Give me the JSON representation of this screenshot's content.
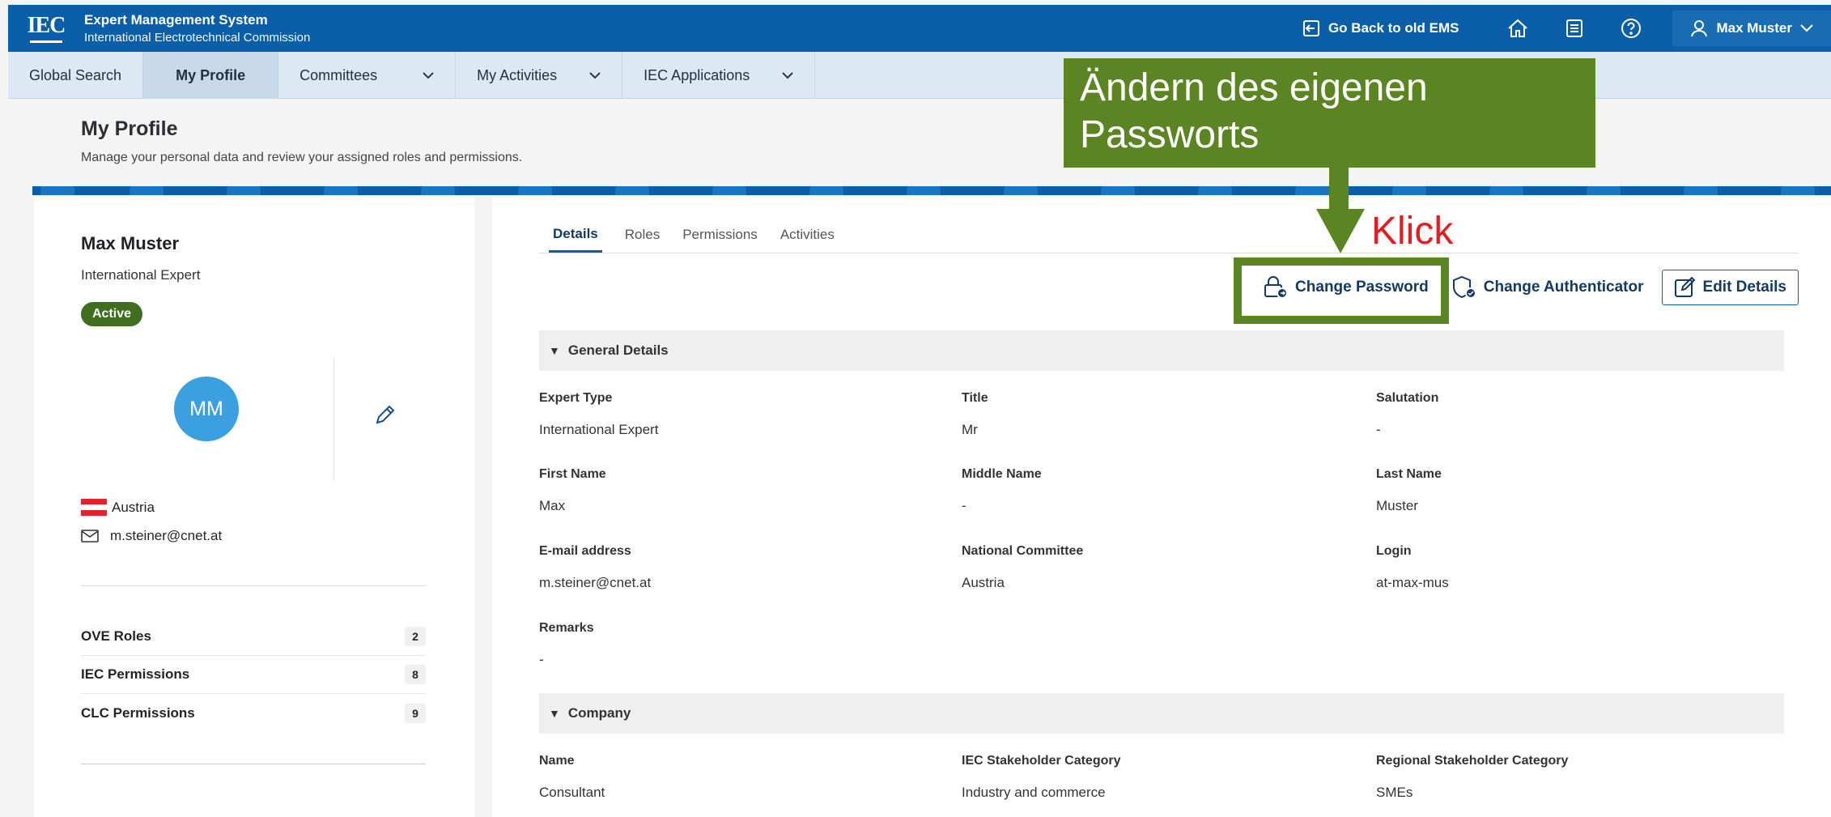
{
  "topbar": {
    "logo_text": "IEC",
    "app_title": "Expert Management System",
    "org_name": "International Electrotechnical Commission",
    "go_back_label": "Go Back to old EMS",
    "user_name": "Max Muster",
    "colors": {
      "bar": "#0a5fa8"
    }
  },
  "nav": {
    "items": [
      {
        "label": "Global Search"
      },
      {
        "label": "My Profile"
      },
      {
        "label": "Committees"
      },
      {
        "label": "My Activities"
      },
      {
        "label": "IEC Applications"
      }
    ]
  },
  "page": {
    "title": "My Profile",
    "subtitle": "Manage your personal data and review your assigned roles and permissions."
  },
  "profile": {
    "name": "Max Muster",
    "expert_type": "International Expert",
    "status": "Active",
    "initials": "MM",
    "country": "Austria",
    "email": "m.steiner@cnet.at",
    "roles": [
      {
        "label": "OVE Roles",
        "count": "2"
      },
      {
        "label": "IEC Permissions",
        "count": "8"
      },
      {
        "label": "CLC Permissions",
        "count": "9"
      }
    ]
  },
  "tabs": [
    {
      "label": "Details"
    },
    {
      "label": "Roles"
    },
    {
      "label": "Permissions"
    },
    {
      "label": "Activities"
    }
  ],
  "actions": {
    "change_password": "Change Password",
    "change_authenticator": "Change Authenticator",
    "edit_details": "Edit Details"
  },
  "general_details": {
    "heading": "General Details",
    "fields": [
      {
        "label": "Expert Type",
        "value": "International Expert"
      },
      {
        "label": "Title",
        "value": "Mr"
      },
      {
        "label": "Salutation",
        "value": "-"
      },
      {
        "label": "First Name",
        "value": "Max"
      },
      {
        "label": "Middle Name",
        "value": "-"
      },
      {
        "label": "Last Name",
        "value": "Muster"
      },
      {
        "label": "E-mail address",
        "value": "m.steiner@cnet.at"
      },
      {
        "label": "National Committee",
        "value": "Austria"
      },
      {
        "label": "Login",
        "value": "at-max-mus"
      },
      {
        "label": "Remarks",
        "value": "-"
      }
    ]
  },
  "company": {
    "heading": "Company",
    "fields": [
      {
        "label": "Name",
        "value": "Consultant"
      },
      {
        "label": "IEC Stakeholder Category",
        "value": "Industry and commerce"
      },
      {
        "label": "Regional Stakeholder Category",
        "value": "SMEs"
      }
    ]
  },
  "annotation": {
    "callout_text": "Ändern des eigenen Passworts",
    "click_text": "Klick",
    "colors": {
      "callout": "#5b8422",
      "click": "#e02020"
    }
  }
}
